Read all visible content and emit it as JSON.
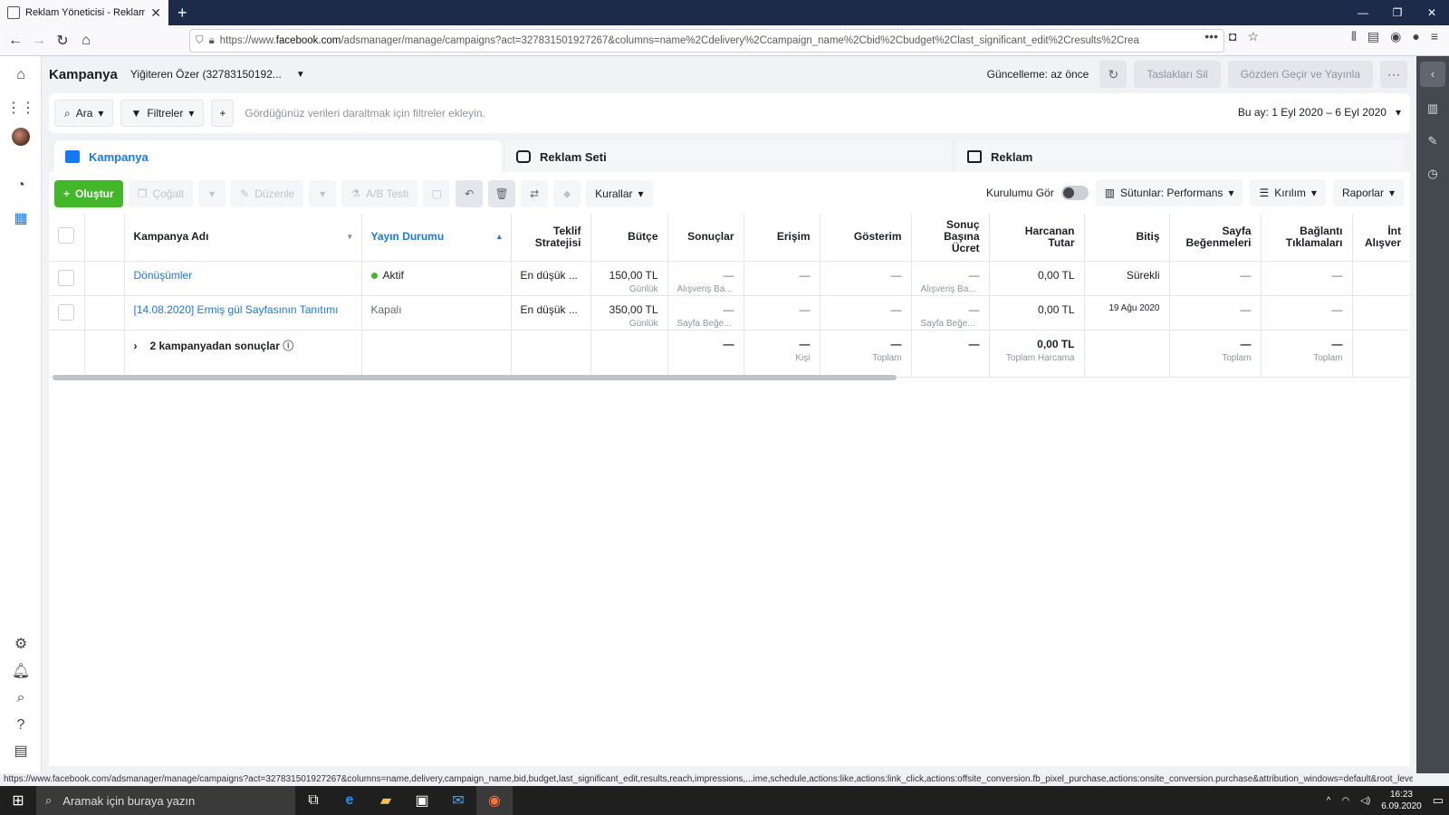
{
  "browser": {
    "tab_title": "Reklam Yöneticisi - Reklamlar",
    "url_prefix": "https://www.",
    "url_domain": "facebook.com",
    "url_rest": "/adsmanager/manage/campaigns?act=327831501927267&columns=name%2Cdelivery%2Ccampaign_name%2Cbid%2Cbudget%2Clast_significant_edit%2Cresults%2Crea",
    "status_url": "https://www.facebook.com/adsmanager/manage/campaigns?act=327831501927267&columns=name,delivery,campaign_name,bid,budget,last_significant_edit,results,reach,impressions,...ime,schedule,actions:like,actions:link_click,actions:offsite_conversion.fb_pixel_purchase,actions:onsite_conversion.purchase&attribution_windows=default&root_level=ad#"
  },
  "header": {
    "title": "Kampanya",
    "account": "Yiğiteren Özer (32783150192...",
    "update_text": "Güncelleme: az önce",
    "delete_drafts": "Taslakları Sil",
    "review_publish": "Gözden Geçir ve Yayınla"
  },
  "filterbar": {
    "search": "Ara",
    "filters": "Filtreler",
    "hint": "Gördüğünüz verileri daraltmak için filtreler ekleyin.",
    "date": "Bu ay: 1 Eyl 2020 – 6 Eyl 2020"
  },
  "tabs": {
    "campaign": "Kampanya",
    "adset": "Reklam Seti",
    "ad": "Reklam"
  },
  "toolbar": {
    "create": "Oluştur",
    "duplicate": "Çoğalt",
    "edit": "Düzenle",
    "ab_test": "A/B Testi",
    "rules": "Kurallar",
    "setup": "Kurulumu Gör",
    "columns": "Sütunlar: Performans",
    "breakdown": "Kırılım",
    "reports": "Raporlar"
  },
  "table": {
    "headers": {
      "name": "Kampanya Adı",
      "delivery": "Yayın Durumu",
      "bid": "Teklif Stratejisi",
      "budget": "Bütçe",
      "results": "Sonuçlar",
      "reach": "Erişim",
      "impressions": "Gösterim",
      "cpr": "Sonuç Başına Ücret",
      "spent": "Harcanan Tutar",
      "end": "Bitiş",
      "likes": "Sayfa Beğenmeleri",
      "clicks": "Bağlantı Tıklamaları",
      "extra": "İnt Alışver"
    },
    "rows": [
      {
        "name": "Dönüşümler",
        "delivery": "Aktif",
        "bid": "En düşük ...",
        "budget": "150,00 TL",
        "budget_sub": "Günlük",
        "results": "—",
        "results_sub": "Alışveriş Ba...",
        "reach": "—",
        "impressions": "—",
        "cpr": "—",
        "cpr_sub": "Alışveriş Ba...",
        "spent": "0,00 TL",
        "end": "Sürekli",
        "likes": "—",
        "clicks": "—"
      },
      {
        "name": "[14.08.2020] Ermiş gül Sayfasının Tanıtımı",
        "delivery": "Kapalı",
        "bid": "En düşük ...",
        "budget": "350,00 TL",
        "budget_sub": "Günlük",
        "results": "—",
        "results_sub": "Sayfa Beğe...",
        "reach": "—",
        "impressions": "—",
        "cpr": "—",
        "cpr_sub": "Sayfa Beğe...",
        "spent": "0,00 TL",
        "end": "19 Ağu 2020",
        "likes": "—",
        "clicks": "—"
      }
    ],
    "totals": {
      "label": "2 kampanyadan sonuçlar",
      "results": "—",
      "reach": "—",
      "reach_sub": "Kişi",
      "impressions": "—",
      "impressions_sub": "Toplam",
      "cpr": "—",
      "spent": "0,00 TL",
      "spent_sub": "Toplam Harcama",
      "likes": "—",
      "likes_sub": "Toplam",
      "clicks": "—",
      "clicks_sub": "Toplam"
    }
  },
  "taskbar": {
    "search": "Aramak için buraya yazın",
    "time": "16:23",
    "date": "6.09.2020"
  }
}
